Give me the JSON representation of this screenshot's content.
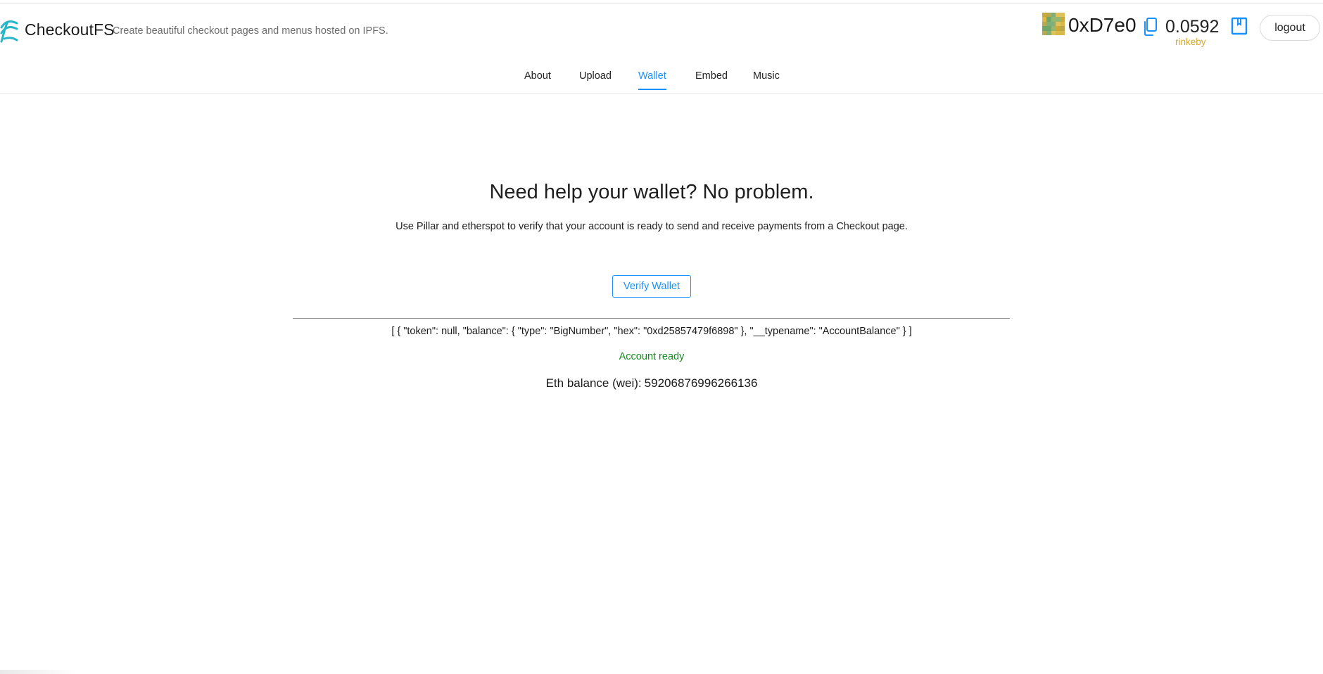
{
  "header": {
    "brand_name": "CheckoutFS",
    "tagline": "Create beautiful checkout pages and menus hosted on IPFS.",
    "logo_icon": "checkoutfs-wave-logo"
  },
  "wallet": {
    "address": "0xD7e0",
    "balance": "0.0592",
    "network": "rinkeby",
    "logout_label": "logout",
    "avatar_icon": "identicon",
    "copy_icon": "copy-icon",
    "bookmark_icon": "bookmark-icon"
  },
  "nav": {
    "tabs": [
      {
        "label": "About",
        "active": false
      },
      {
        "label": "Upload",
        "active": false
      },
      {
        "label": "Wallet",
        "active": true
      },
      {
        "label": "Embed",
        "active": false
      },
      {
        "label": "Music",
        "active": false
      }
    ]
  },
  "main": {
    "headline": "Need help your wallet? No problem.",
    "subtext": "Use Pillar and etherspot to verify that your account is ready to send and receive payments from a Checkout page.",
    "verify_label": "Verify Wallet",
    "json_output": "[ { \"token\": null, \"balance\": { \"type\": \"BigNumber\", \"hex\": \"0xd25857479f6898\" }, \"__typename\": \"AccountBalance\" } ]",
    "status": "Account ready",
    "eth_balance_label": "Eth balance (wei):",
    "eth_balance_value": "59206876996266136"
  },
  "colors": {
    "accent": "#1890ff",
    "success": "#138a1f",
    "network": "#d4a72c",
    "logo_teal": "#26b5c9"
  }
}
